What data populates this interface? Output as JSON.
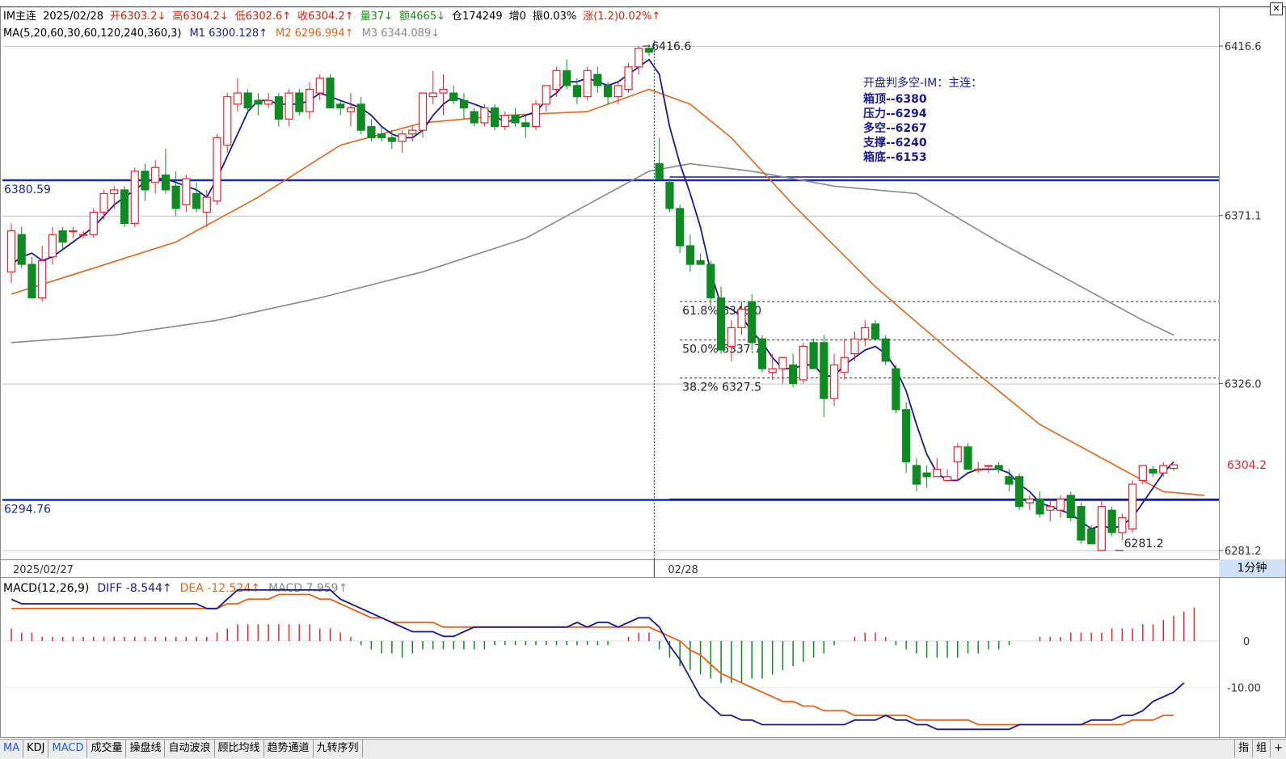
{
  "header": {
    "line1": [
      {
        "text": "IM主连",
        "color": "#000000"
      },
      {
        "text": "2025/02/28",
        "color": "#000000"
      },
      {
        "text": "开6303.2↓",
        "color": "#d81e06"
      },
      {
        "text": "高6304.2↓",
        "color": "#d81e06"
      },
      {
        "text": "低6302.6↑",
        "color": "#d81e06"
      },
      {
        "text": "收6304.2↑",
        "color": "#d81e06"
      },
      {
        "text": "量37↓",
        "color": "#1a8a1a"
      },
      {
        "text": "额4665↓",
        "color": "#1a8a1a"
      },
      {
        "text": "仓174249",
        "color": "#000000"
      },
      {
        "text": "增0",
        "color": "#000000"
      },
      {
        "text": "振0.03%",
        "color": "#000000"
      },
      {
        "text": "涨(1.2)0.02%↑",
        "color": "#d81e06"
      }
    ],
    "line2": [
      {
        "text": "MA(5,20,60,30,60,120,240,360,3)",
        "color": "#000000"
      },
      {
        "text": "M1 6300.128↑",
        "color": "#1a1a8c"
      },
      {
        "text": "M2 6296.994↑",
        "color": "#e0651b"
      },
      {
        "text": "M3 6344.089↓",
        "color": "#888888"
      }
    ]
  },
  "price_axis": {
    "labels": [
      "6416.6",
      "6371.1",
      "6326.0",
      "6281.2"
    ],
    "current_price": "6304.2"
  },
  "date_labels": [
    "2025/02/27",
    "02/28"
  ],
  "price_lines": [
    {
      "label": "6380.59",
      "value": 6380.59
    },
    {
      "label": "6294.76",
      "value": 6294.76
    }
  ],
  "annotation_box": {
    "title": "开盘判多空-IM：主连：",
    "lines": [
      "箱顶--6380",
      "压力--6294",
      "多空--6267",
      "支撑--6240",
      "箱底--6153"
    ]
  },
  "fib_levels": [
    {
      "label": "61.8% 6348.0",
      "value": 6348.0
    },
    {
      "label": "50.0% 6337.7",
      "value": 6337.7
    },
    {
      "label": "38.2% 6327.5",
      "value": 6327.5
    }
  ],
  "peak_label": "6416.6",
  "trough_label": "6281.2",
  "macd": {
    "header": [
      {
        "text": "MACD(12,26,9)",
        "color": "#000000"
      },
      {
        "text": "DIFF -8.544↑",
        "color": "#1a1a8c"
      },
      {
        "text": "DEA -12.524↑",
        "color": "#e0651b"
      },
      {
        "text": "MACD 7.959↑",
        "color": "#888888"
      }
    ],
    "axis_labels": [
      "0",
      "-10.00"
    ]
  },
  "period_label": "1分钟",
  "tabs": [
    "MA",
    "KDJ",
    "MACD",
    "成交量",
    "操盘线",
    "自动波浪",
    "顾比均线",
    "趋势通道",
    "九转序列"
  ],
  "active_tabs": [
    "MA",
    "MACD"
  ],
  "tabs_right": [
    "指",
    "组",
    "+"
  ],
  "colors": {
    "up": "#e8242c",
    "down": "#0f8a22",
    "ma1": "#1a1a8c",
    "ma2": "#e0651b",
    "ma3": "#888888",
    "hline": "#1428c8",
    "grid": "#555555"
  },
  "chart_data": {
    "type": "candlestick",
    "ylim": [
      6281.2,
      6416.6
    ],
    "candles": [
      {
        "o": 6356,
        "h": 6369,
        "l": 6353,
        "c": 6367
      },
      {
        "o": 6366,
        "h": 6368,
        "l": 6357,
        "c": 6358
      },
      {
        "o": 6358,
        "h": 6360,
        "l": 6349,
        "c": 6349
      },
      {
        "o": 6349,
        "h": 6363,
        "l": 6348,
        "c": 6359
      },
      {
        "o": 6360,
        "h": 6368,
        "l": 6358,
        "c": 6366
      },
      {
        "o": 6367,
        "h": 6368,
        "l": 6362,
        "c": 6364
      },
      {
        "o": 6367,
        "h": 6368,
        "l": 6365,
        "c": 6367
      },
      {
        "o": 6366,
        "h": 6367,
        "l": 6365,
        "c": 6366
      },
      {
        "o": 6366,
        "h": 6373,
        "l": 6365,
        "c": 6372
      },
      {
        "o": 6372,
        "h": 6378,
        "l": 6370,
        "c": 6377
      },
      {
        "o": 6377,
        "h": 6379,
        "l": 6373,
        "c": 6378
      },
      {
        "o": 6378,
        "h": 6379,
        "l": 6368,
        "c": 6369
      },
      {
        "o": 6369,
        "h": 6384,
        "l": 6368,
        "c": 6383
      },
      {
        "o": 6383,
        "h": 6385,
        "l": 6375,
        "c": 6378
      },
      {
        "o": 6380,
        "h": 6386,
        "l": 6377,
        "c": 6384
      },
      {
        "o": 6382,
        "h": 6389,
        "l": 6377,
        "c": 6378
      },
      {
        "o": 6379,
        "h": 6383,
        "l": 6371,
        "c": 6373
      },
      {
        "o": 6374,
        "h": 6382,
        "l": 6372,
        "c": 6381
      },
      {
        "o": 6377,
        "h": 6380,
        "l": 6372,
        "c": 6373
      },
      {
        "o": 6372,
        "h": 6378,
        "l": 6368,
        "c": 6376
      },
      {
        "o": 6375,
        "h": 6393,
        "l": 6374,
        "c": 6392
      },
      {
        "o": 6390,
        "h": 6404,
        "l": 6388,
        "c": 6403
      },
      {
        "o": 6401,
        "h": 6408,
        "l": 6399,
        "c": 6404
      },
      {
        "o": 6404,
        "h": 6405,
        "l": 6399,
        "c": 6400
      },
      {
        "o": 6402,
        "h": 6404,
        "l": 6398,
        "c": 6401
      },
      {
        "o": 6401,
        "h": 6404,
        "l": 6400,
        "c": 6402
      },
      {
        "o": 6403,
        "h": 6404,
        "l": 6395,
        "c": 6397
      },
      {
        "o": 6397,
        "h": 6405,
        "l": 6395,
        "c": 6404
      },
      {
        "o": 6404,
        "h": 6405,
        "l": 6398,
        "c": 6399
      },
      {
        "o": 6399,
        "h": 6407,
        "l": 6397,
        "c": 6405
      },
      {
        "o": 6404,
        "h": 6409,
        "l": 6402,
        "c": 6408
      },
      {
        "o": 6408,
        "h": 6409,
        "l": 6400,
        "c": 6400
      },
      {
        "o": 6401,
        "h": 6402,
        "l": 6398,
        "c": 6400
      },
      {
        "o": 6399,
        "h": 6404,
        "l": 6395,
        "c": 6400
      },
      {
        "o": 6401,
        "h": 6403,
        "l": 6393,
        "c": 6394
      },
      {
        "o": 6395,
        "h": 6397,
        "l": 6391,
        "c": 6392
      },
      {
        "o": 6393,
        "h": 6395,
        "l": 6391,
        "c": 6392
      },
      {
        "o": 6392,
        "h": 6394,
        "l": 6389,
        "c": 6391
      },
      {
        "o": 6391,
        "h": 6394,
        "l": 6388,
        "c": 6393
      },
      {
        "o": 6393,
        "h": 6395,
        "l": 6391,
        "c": 6394
      },
      {
        "o": 6394,
        "h": 6404,
        "l": 6392,
        "c": 6404
      },
      {
        "o": 6403,
        "h": 6410,
        "l": 6401,
        "c": 6404
      },
      {
        "o": 6404,
        "h": 6409,
        "l": 6398,
        "c": 6405
      },
      {
        "o": 6404,
        "h": 6406,
        "l": 6401,
        "c": 6402
      },
      {
        "o": 6402,
        "h": 6404,
        "l": 6397,
        "c": 6400
      },
      {
        "o": 6399,
        "h": 6400,
        "l": 6395,
        "c": 6396
      },
      {
        "o": 6396,
        "h": 6401,
        "l": 6395,
        "c": 6400
      },
      {
        "o": 6400,
        "h": 6401,
        "l": 6394,
        "c": 6395
      },
      {
        "o": 6395,
        "h": 6399,
        "l": 6394,
        "c": 6398
      },
      {
        "o": 6398,
        "h": 6400,
        "l": 6395,
        "c": 6396
      },
      {
        "o": 6396,
        "h": 6398,
        "l": 6392,
        "c": 6395
      },
      {
        "o": 6395,
        "h": 6402,
        "l": 6394,
        "c": 6401
      },
      {
        "o": 6401,
        "h": 6406,
        "l": 6399,
        "c": 6406
      },
      {
        "o": 6405,
        "h": 6411,
        "l": 6403,
        "c": 6410
      },
      {
        "o": 6410,
        "h": 6413,
        "l": 6405,
        "c": 6406
      },
      {
        "o": 6406,
        "h": 6408,
        "l": 6401,
        "c": 6403
      },
      {
        "o": 6403,
        "h": 6411,
        "l": 6402,
        "c": 6410
      },
      {
        "o": 6409,
        "h": 6411,
        "l": 6404,
        "c": 6406
      },
      {
        "o": 6406,
        "h": 6407,
        "l": 6401,
        "c": 6403
      },
      {
        "o": 6403,
        "h": 6407,
        "l": 6401,
        "c": 6406
      },
      {
        "o": 6405,
        "h": 6412,
        "l": 6404,
        "c": 6411
      },
      {
        "o": 6411,
        "h": 6416.6,
        "l": 6409,
        "c": 6416
      },
      {
        "o": 6416,
        "h": 6417,
        "l": 6414,
        "c": 6415
      },
      {
        "o": 6385,
        "h": 6392,
        "l": 6381,
        "c": 6381
      },
      {
        "o": 6380,
        "h": 6381,
        "l": 6372,
        "c": 6373
      },
      {
        "o": 6373,
        "h": 6374,
        "l": 6361,
        "c": 6363
      },
      {
        "o": 6363,
        "h": 6366,
        "l": 6356,
        "c": 6358
      },
      {
        "o": 6359,
        "h": 6361,
        "l": 6358,
        "c": 6358
      },
      {
        "o": 6358,
        "h": 6359,
        "l": 6347,
        "c": 6349
      },
      {
        "o": 6349,
        "h": 6352,
        "l": 6334,
        "c": 6335
      },
      {
        "o": 6336,
        "h": 6343,
        "l": 6332,
        "c": 6341
      },
      {
        "o": 6341,
        "h": 6348,
        "l": 6339,
        "c": 6346
      },
      {
        "o": 6348,
        "h": 6350,
        "l": 6335,
        "c": 6337
      },
      {
        "o": 6338,
        "h": 6339,
        "l": 6329,
        "c": 6330
      },
      {
        "o": 6329,
        "h": 6334,
        "l": 6327,
        "c": 6330
      },
      {
        "o": 6330,
        "h": 6333,
        "l": 6326,
        "c": 6333
      },
      {
        "o": 6331,
        "h": 6334,
        "l": 6325,
        "c": 6326
      },
      {
        "o": 6327,
        "h": 6337,
        "l": 6326,
        "c": 6336
      },
      {
        "o": 6337,
        "h": 6338,
        "l": 6330,
        "c": 6330
      },
      {
        "o": 6337,
        "h": 6339,
        "l": 6317,
        "c": 6322
      },
      {
        "o": 6322,
        "h": 6334,
        "l": 6320,
        "c": 6331
      },
      {
        "o": 6329,
        "h": 6338,
        "l": 6327,
        "c": 6333
      },
      {
        "o": 6334,
        "h": 6340,
        "l": 6332,
        "c": 6338
      },
      {
        "o": 6338,
        "h": 6343,
        "l": 6336,
        "c": 6341
      },
      {
        "o": 6342,
        "h": 6343,
        "l": 6338,
        "c": 6338
      },
      {
        "o": 6338,
        "h": 6339,
        "l": 6331,
        "c": 6332
      },
      {
        "o": 6330,
        "h": 6331,
        "l": 6318,
        "c": 6319
      },
      {
        "o": 6319,
        "h": 6321,
        "l": 6302,
        "c": 6305
      },
      {
        "o": 6304,
        "h": 6306,
        "l": 6297,
        "c": 6299
      },
      {
        "o": 6302,
        "h": 6304,
        "l": 6298,
        "c": 6301
      },
      {
        "o": 6301,
        "h": 6306,
        "l": 6301,
        "c": 6303
      },
      {
        "o": 6300,
        "h": 6303,
        "l": 6300,
        "c": 6301
      },
      {
        "o": 6305,
        "h": 6310,
        "l": 6300,
        "c": 6309
      },
      {
        "o": 6309,
        "h": 6310,
        "l": 6303,
        "c": 6303
      },
      {
        "o": 6303,
        "h": 6305,
        "l": 6302,
        "c": 6303
      },
      {
        "o": 6304,
        "h": 6304,
        "l": 6302,
        "c": 6304
      },
      {
        "o": 6304,
        "h": 6305,
        "l": 6302,
        "c": 6303
      },
      {
        "o": 6301,
        "h": 6303,
        "l": 6297,
        "c": 6299
      },
      {
        "o": 6301,
        "h": 6302,
        "l": 6292,
        "c": 6293
      },
      {
        "o": 6294,
        "h": 6296,
        "l": 6292,
        "c": 6295
      },
      {
        "o": 6295,
        "h": 6297,
        "l": 6290,
        "c": 6291
      },
      {
        "o": 6292,
        "h": 6295,
        "l": 6289,
        "c": 6293
      },
      {
        "o": 6292,
        "h": 6296,
        "l": 6290,
        "c": 6295
      },
      {
        "o": 6296,
        "h": 6297,
        "l": 6289,
        "c": 6290
      },
      {
        "o": 6293,
        "h": 6294,
        "l": 6283,
        "c": 6284
      },
      {
        "o": 6287,
        "h": 6288,
        "l": 6283,
        "c": 6283
      },
      {
        "o": 6281.2,
        "h": 6295,
        "l": 6281.2,
        "c": 6293
      },
      {
        "o": 6292,
        "h": 6293,
        "l": 6285,
        "c": 6286
      },
      {
        "o": 6286,
        "h": 6291,
        "l": 6284,
        "c": 6290
      },
      {
        "o": 6287,
        "h": 6300,
        "l": 6286,
        "c": 6299
      },
      {
        "o": 6300,
        "h": 6304,
        "l": 6299,
        "c": 6304
      },
      {
        "o": 6303,
        "h": 6304,
        "l": 6301,
        "c": 6302
      },
      {
        "o": 6302,
        "h": 6305,
        "l": 6301,
        "c": 6304
      },
      {
        "o": 6303.2,
        "h": 6304.2,
        "l": 6302.6,
        "c": 6304.2
      }
    ],
    "ma5": [
      6358,
      6360,
      6361,
      6359,
      6360,
      6362,
      6364,
      6366,
      6368,
      6371,
      6374,
      6376,
      6378,
      6380,
      6381,
      6381,
      6380,
      6379,
      6378,
      6376,
      6381,
      6387,
      6393,
      6399,
      6402,
      6402,
      6401,
      6401,
      6401,
      6402,
      6404,
      6403,
      6402,
      6401,
      6400,
      6398,
      6395,
      6393,
      6392,
      6392,
      6394,
      6398,
      6401,
      6403,
      6402,
      6401,
      6400,
      6398,
      6396,
      6397,
      6398,
      6399,
      6402,
      6404,
      6407,
      6407,
      6408,
      6407,
      6406,
      6407,
      6409,
      6411,
      6413,
      6409,
      6395,
      6385,
      6377,
      6368,
      6356,
      6347,
      6346,
      6344,
      6340,
      6337,
      6333,
      6330,
      6330,
      6331,
      6331,
      6328,
      6328,
      6331,
      6333,
      6335,
      6336,
      6334,
      6330,
      6324,
      6315,
      6307,
      6302,
      6300,
      6300,
      6302,
      6303,
      6303,
      6303,
      6302,
      6299,
      6297,
      6294,
      6293,
      6292,
      6291,
      6289,
      6287,
      6288,
      6287,
      6288,
      6290,
      6294,
      6298,
      6302,
      6305
    ]
  },
  "ma2_points": [
    [
      0,
      6350
    ],
    [
      8,
      6357
    ],
    [
      16,
      6364
    ],
    [
      24,
      6376
    ],
    [
      32,
      6390
    ],
    [
      40,
      6396
    ],
    [
      48,
      6398
    ],
    [
      56,
      6399
    ],
    [
      62,
      6405
    ],
    [
      66,
      6401
    ],
    [
      70,
      6392
    ],
    [
      76,
      6374
    ],
    [
      84,
      6352
    ],
    [
      92,
      6333
    ],
    [
      100,
      6315
    ],
    [
      108,
      6303
    ],
    [
      112,
      6297
    ],
    [
      116,
      6296
    ]
  ],
  "ma3_points": [
    [
      0,
      6337
    ],
    [
      10,
      6339
    ],
    [
      20,
      6343
    ],
    [
      30,
      6349
    ],
    [
      40,
      6356
    ],
    [
      50,
      6365
    ],
    [
      56,
      6374
    ],
    [
      62,
      6383
    ],
    [
      66,
      6385
    ],
    [
      72,
      6383
    ],
    [
      80,
      6379
    ],
    [
      88,
      6377
    ],
    [
      96,
      6364
    ],
    [
      104,
      6352
    ],
    [
      110,
      6343
    ],
    [
      113,
      6339
    ]
  ],
  "macd_series": {
    "hist": [
      3,
      2,
      2,
      1,
      1,
      1,
      1,
      1,
      1,
      1,
      1,
      1,
      1,
      1,
      1,
      1,
      1,
      1,
      1,
      1,
      2,
      3,
      4,
      4,
      4,
      4,
      4,
      4,
      4,
      4,
      3,
      3,
      2,
      1,
      -1,
      -2,
      -3,
      -3,
      -4,
      -3,
      -2,
      -2,
      -2,
      -2,
      -2,
      -2,
      -2,
      -1,
      -1,
      -1,
      -1,
      -1,
      -1,
      -1,
      -1,
      -1,
      -1,
      -1,
      -1,
      0,
      1,
      2,
      2,
      -2,
      -4,
      -6,
      -7,
      -8,
      -9,
      -10,
      -10,
      -10,
      -9,
      -9,
      -8,
      -7,
      -6,
      -5,
      -4,
      -3,
      -1,
      0,
      1,
      2,
      2,
      1,
      -1,
      -2,
      -3,
      -4,
      -4,
      -4,
      -4,
      -3,
      -3,
      -2,
      -2,
      -1,
      0,
      0,
      1,
      1,
      1,
      2,
      2,
      2,
      2,
      3,
      3,
      3,
      4,
      4,
      5,
      6,
      7,
      8
    ],
    "diff": [
      9,
      8,
      8,
      8,
      8,
      8,
      8,
      8,
      8,
      8,
      8,
      8,
      8,
      8,
      8,
      8,
      8,
      8,
      8,
      7,
      7,
      9,
      11,
      11,
      11,
      11,
      11,
      11,
      11,
      11,
      11,
      11,
      9,
      8,
      7,
      6,
      5,
      4,
      3,
      2,
      2,
      2,
      1,
      1,
      2,
      3,
      3,
      3,
      3,
      3,
      3,
      3,
      3,
      3,
      3,
      4,
      3,
      4,
      4,
      3,
      4,
      5,
      5,
      3,
      -1,
      -4,
      -8,
      -12,
      -14,
      -16,
      -16,
      -17,
      -17,
      -18,
      -18,
      -18,
      -18,
      -18,
      -18,
      -18,
      -18,
      -18,
      -17,
      -17,
      -17,
      -16,
      -17,
      -17,
      -18,
      -18,
      -19,
      -19,
      -19,
      -19,
      -19,
      -19,
      -19,
      -19,
      -18,
      -18,
      -18,
      -18,
      -18,
      -18,
      -18,
      -17,
      -17,
      -17,
      -16,
      -16,
      -15,
      -13,
      -12,
      -11,
      -9
    ],
    "dea": [
      7,
      7,
      7,
      7,
      7,
      7,
      7,
      7,
      7,
      7,
      7,
      7,
      7,
      7,
      7,
      7,
      7,
      7,
      7,
      7,
      7,
      8,
      8,
      9,
      9,
      9,
      10,
      10,
      10,
      10,
      9,
      9,
      8,
      7,
      6,
      5,
      5,
      4,
      4,
      4,
      4,
      4,
      3,
      3,
      3,
      3,
      3,
      3,
      3,
      3,
      3,
      3,
      3,
      3,
      3,
      3,
      3,
      3,
      3,
      3,
      3,
      3,
      3,
      2,
      1,
      0,
      -2,
      -3,
      -5,
      -7,
      -8,
      -9,
      -10,
      -11,
      -12,
      -13,
      -13,
      -14,
      -14,
      -15,
      -15,
      -15,
      -16,
      -16,
      -16,
      -16,
      -16,
      -16,
      -17,
      -17,
      -17,
      -17,
      -17,
      -17,
      -18,
      -18,
      -18,
      -18,
      -18,
      -18,
      -18,
      -18,
      -18,
      -18,
      -18,
      -18,
      -18,
      -18,
      -18,
      -17,
      -17,
      -17,
      -16,
      -16
    ]
  }
}
